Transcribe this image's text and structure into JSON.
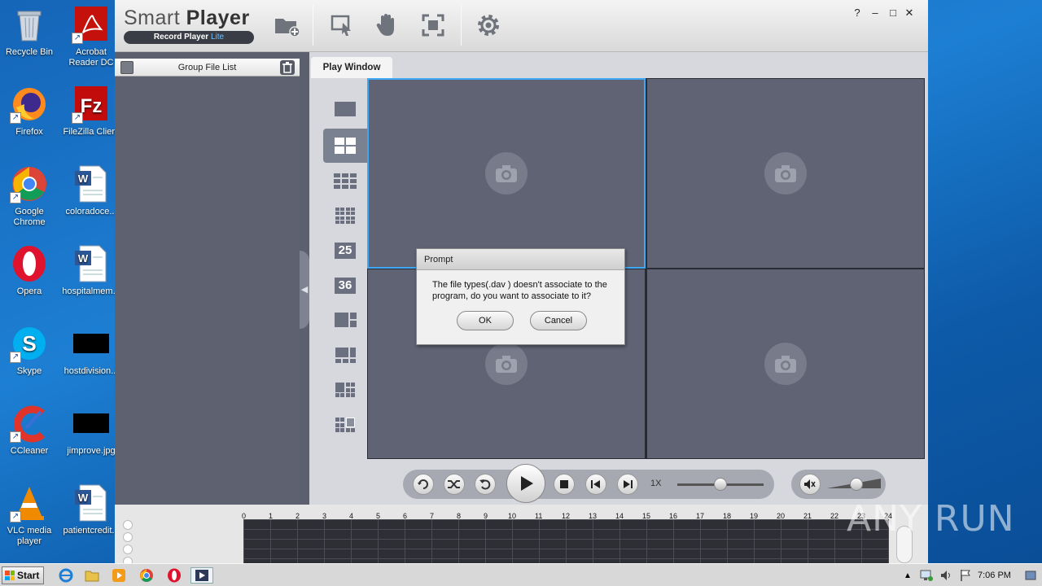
{
  "desktop": {
    "icons": [
      {
        "label": "Recycle Bin"
      },
      {
        "label": "Acrobat Reader DC"
      },
      {
        "label": "Firefox"
      },
      {
        "label": "FileZilla Client"
      },
      {
        "label": "Google Chrome"
      },
      {
        "label": "coloradoce..."
      },
      {
        "label": "Opera"
      },
      {
        "label": "hospitalmem..."
      },
      {
        "label": "Skype"
      },
      {
        "label": "hostdivision..."
      },
      {
        "label": "CCleaner"
      },
      {
        "label": "jimprove.jpg"
      },
      {
        "label": "VLC media player"
      },
      {
        "label": "patientcredit..."
      }
    ],
    "watermark": "ANY RUN"
  },
  "app": {
    "title_main": "Smart ",
    "title_bold": "Player",
    "subtitle": "Record Player ",
    "subtitle_lite": "Lite",
    "window_controls": {
      "help": "?",
      "minimize": "–",
      "maximize": "□",
      "close": "✕"
    },
    "group_file_list": {
      "title": "Group File List"
    },
    "play_window": {
      "tab": "Play Window"
    },
    "layouts": [
      "1",
      "4",
      "9",
      "16",
      "25",
      "36",
      "custom-1",
      "custom-2",
      "custom-3",
      "custom-4"
    ],
    "layout_25": "25",
    "layout_36": "36",
    "selected_layout_index": 1,
    "controls": {
      "speed": "1X",
      "speed_slider_position": 0.5,
      "volume_level": 0.55
    },
    "timeline": {
      "hours": [
        "0",
        "1",
        "2",
        "3",
        "4",
        "5",
        "6",
        "7",
        "8",
        "9",
        "10",
        "11",
        "12",
        "13",
        "14",
        "15",
        "16",
        "17",
        "18",
        "19",
        "20",
        "21",
        "22",
        "23",
        "24"
      ]
    }
  },
  "dialog": {
    "title": "Prompt",
    "message": "The file types(.dav ) doesn't associate to the program, do you want to associate to it?",
    "ok": "OK",
    "cancel": "Cancel"
  },
  "taskbar": {
    "start": "Start",
    "time": "7:06 PM"
  },
  "colors": {
    "accent_blue": "#3fa8f4",
    "panel_gray": "#5f6374",
    "desktop_blue": "#1d7fd3"
  }
}
